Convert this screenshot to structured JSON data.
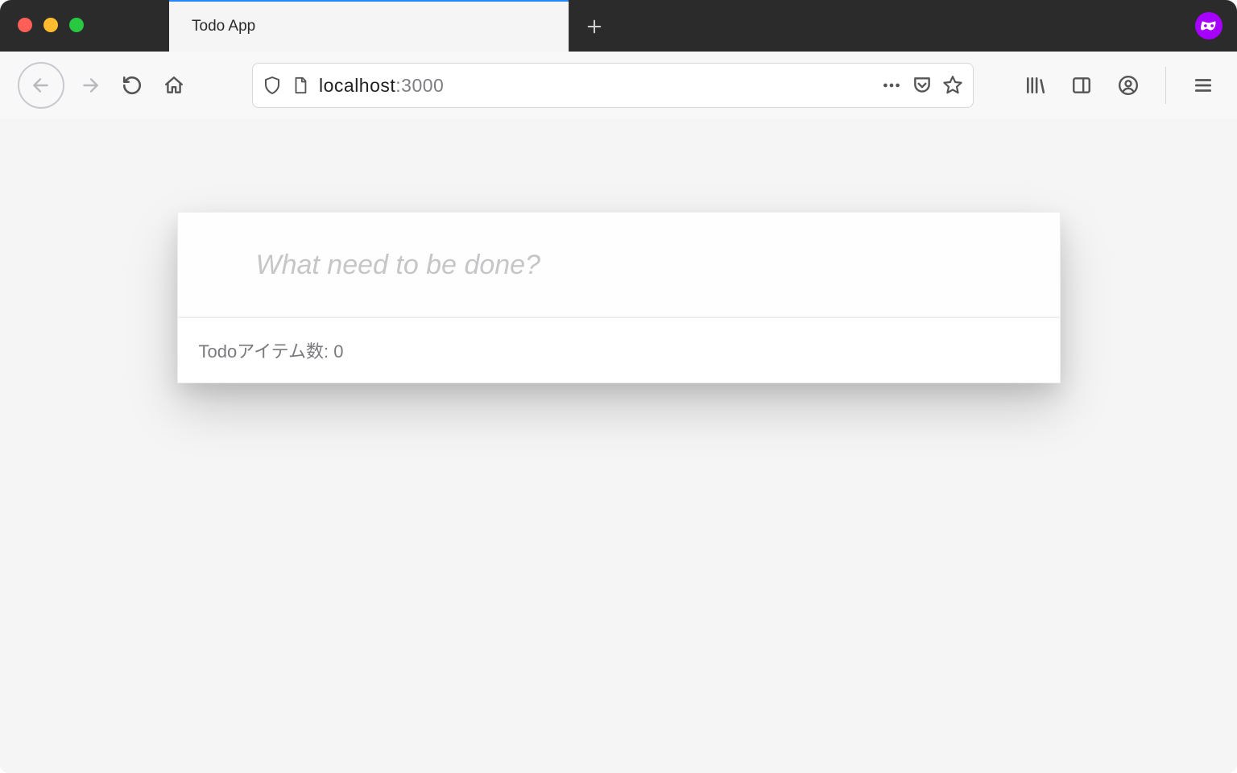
{
  "browser": {
    "tab_title": "Todo App",
    "url_host": "localhost",
    "url_port": ":3000",
    "icons": {
      "close": "close-icon",
      "newtab": "plus-icon",
      "back": "arrow-left-icon",
      "forward": "arrow-right-icon",
      "reload": "reload-icon",
      "home": "home-icon",
      "shield": "shield-icon",
      "pagefile": "page-file-icon",
      "meatballs": "meatballs-icon",
      "pocket": "pocket-icon",
      "star": "star-icon",
      "library": "library-icon",
      "sidebar": "sidebar-icon",
      "account": "account-icon",
      "menu": "hamburger-icon",
      "private": "mask-icon"
    }
  },
  "app": {
    "new_todo_placeholder": "What need to be done?",
    "footer_text": "Todoアイテム数: 0"
  }
}
